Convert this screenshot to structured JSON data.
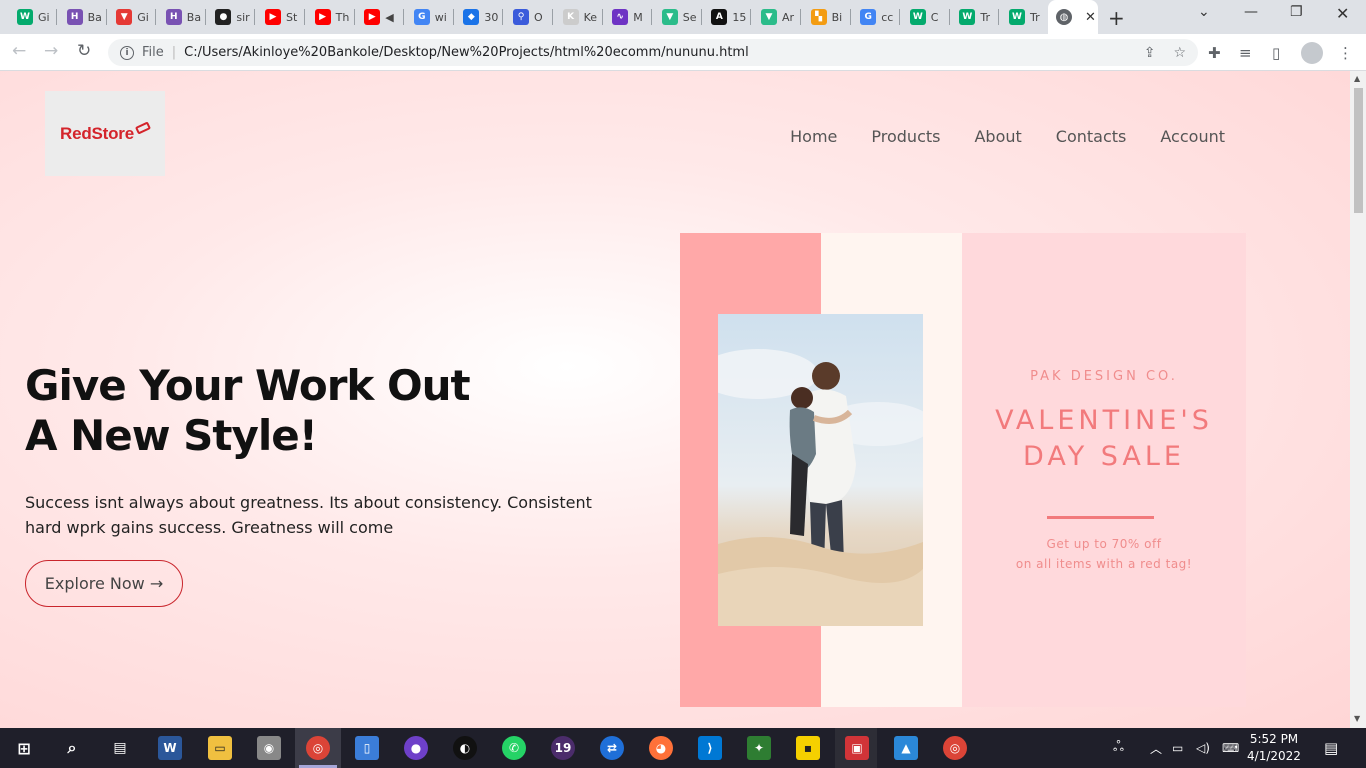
{
  "browser": {
    "tabs": [
      {
        "label": "Gi",
        "icon": "w3schools-icon",
        "color": "#04aa6d",
        "glyph": "W"
      },
      {
        "label": "Ba",
        "icon": "bootstrap-icon",
        "color": "#7952b3",
        "glyph": "H"
      },
      {
        "label": "Gi",
        "icon": "vuetify-icon",
        "color": "#e53935",
        "glyph": "▼"
      },
      {
        "label": "Ba",
        "icon": "bootstrap-icon",
        "color": "#7952b3",
        "glyph": "H"
      },
      {
        "label": "sir",
        "icon": "github-icon",
        "color": "#222222",
        "glyph": "●"
      },
      {
        "label": "St",
        "icon": "youtube-icon",
        "color": "#ff0000",
        "glyph": "▶"
      },
      {
        "label": "Th",
        "icon": "youtube-icon",
        "color": "#ff0000",
        "glyph": "▶"
      },
      {
        "label": "◀",
        "icon": "youtube-audio-icon",
        "color": "#ff0000",
        "glyph": "▶"
      },
      {
        "label": "wi",
        "icon": "google-icon",
        "color": "#4285f4",
        "glyph": "G"
      },
      {
        "label": "30",
        "icon": "app-icon",
        "color": "#1a73e8",
        "glyph": "◆"
      },
      {
        "label": "O",
        "icon": "maps-pin-icon",
        "color": "#3b5bdb",
        "glyph": "⚲"
      },
      {
        "label": "Ke",
        "icon": "app-icon",
        "color": "#cccccc",
        "glyph": "K"
      },
      {
        "label": "M",
        "icon": "chart-app-icon",
        "color": "#6e33c4",
        "glyph": "∿"
      },
      {
        "label": "Se",
        "icon": "vuetify-icon",
        "color": "#2bbc8a",
        "glyph": "▼"
      },
      {
        "label": "15",
        "icon": "app-icon",
        "color": "#111111",
        "glyph": "A"
      },
      {
        "label": "Ar",
        "icon": "vuetify-icon",
        "color": "#2bbc8a",
        "glyph": "▼"
      },
      {
        "label": "Bi",
        "icon": "app-icon",
        "color": "#f39c12",
        "glyph": "▚"
      },
      {
        "label": "cc",
        "icon": "google-icon",
        "color": "#4285f4",
        "glyph": "G"
      },
      {
        "label": "C",
        "icon": "w3schools-icon",
        "color": "#04aa6d",
        "glyph": "W"
      },
      {
        "label": "Tr",
        "icon": "w3schools-icon",
        "color": "#04aa6d",
        "glyph": "W"
      },
      {
        "label": "Tr",
        "icon": "w3schools-icon",
        "color": "#04aa6d",
        "glyph": "W"
      }
    ],
    "active_tab_close": "✕",
    "new_tab": "+",
    "address_prefix": "File",
    "url": "C:/Users/Akinloye%20Bankole/Desktop/New%20Projects/html%20ecomm/nununu.html"
  },
  "site": {
    "logo_text": "RedStore",
    "nav": [
      "Home",
      "Products",
      "About",
      "Contacts",
      "Account"
    ],
    "hero": {
      "title_line1": "Give Your Work Out",
      "title_line2": "A New Style!",
      "text": "Success isnt always about greatness. Its about consistency. Consistent hard wprk gains success. Greatness will come",
      "button": "Explore Now →"
    },
    "poster": {
      "brand": "PAK DESIGN CO.",
      "sale_line1": "VALENTINE'S",
      "sale_line2": "DAY SALE",
      "offer_line1": "Get up to 70% off",
      "offer_line2": "on all items with a red tag!"
    }
  },
  "taskbar": {
    "time": "5:52 PM",
    "date": "4/1/2022",
    "badge_19": "19"
  }
}
